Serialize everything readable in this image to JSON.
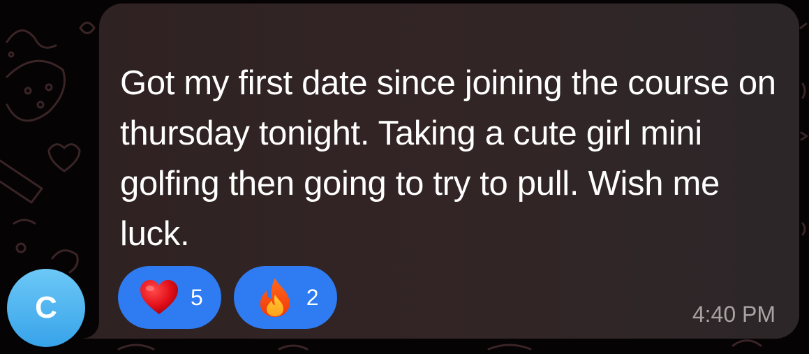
{
  "sender": {
    "avatar_initial": "C",
    "avatar_color": "#4db6f0"
  },
  "message": {
    "text": "Got my first date since joining the course on thursday tonight. Taking a cute girl mini golfing then going to try to pull. Wish me luck.",
    "timestamp": "4:40 PM",
    "bubble_color": "#312425"
  },
  "reactions": [
    {
      "icon": "heart-icon",
      "count": "5"
    },
    {
      "icon": "fire-icon",
      "count": "2"
    }
  ],
  "colors": {
    "reaction_bg": "#2e7bf2",
    "background": "#050304"
  }
}
